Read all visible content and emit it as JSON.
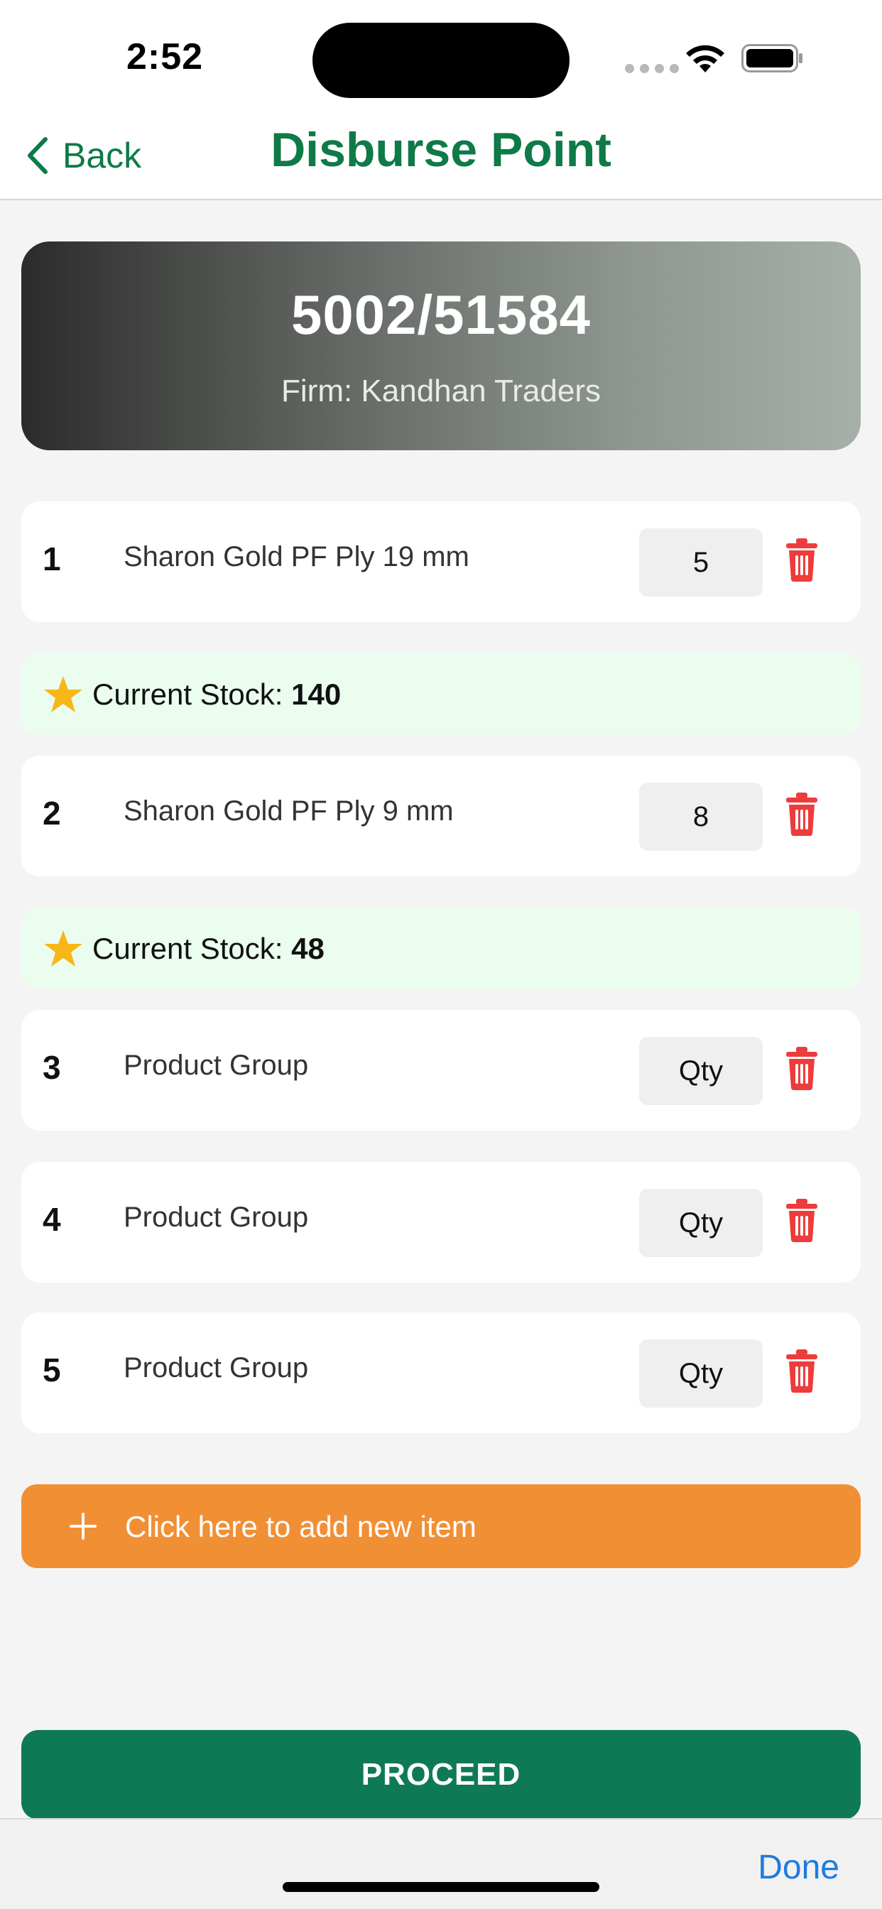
{
  "status": {
    "time": "2:52"
  },
  "nav": {
    "back_label": "Back",
    "title": "Disburse Point"
  },
  "header": {
    "bill_number": "5002/51584",
    "firm_line": "Firm: Kandhan Traders"
  },
  "items": [
    {
      "index": "1",
      "name": "Sharon Gold PF Ply 19 mm",
      "qty": "5",
      "stock_label": "Current Stock: ",
      "stock_value": "140"
    },
    {
      "index": "2",
      "name": "Sharon Gold PF Ply 9 mm",
      "qty": "8",
      "stock_label": "Current Stock: ",
      "stock_value": "48"
    },
    {
      "index": "3",
      "name": "Product Group",
      "qty_placeholder": "Qty"
    },
    {
      "index": "4",
      "name": "Product Group",
      "qty_placeholder": "Qty"
    },
    {
      "index": "5",
      "name": "Product Group",
      "qty_placeholder": "Qty"
    }
  ],
  "add_item_label": "Click here to add new item",
  "proceed_label": "PROCEED",
  "keyboard_done_label": "Done",
  "icons": {
    "back": "chevron-left-icon",
    "delete": "trash-icon",
    "stock": "star-icon",
    "add": "plus-icon"
  },
  "colors": {
    "brand_green": "#0e7a47",
    "delete_red": "#ee3b3b",
    "add_orange": "#f18f35",
    "stock_bg": "#eafdee",
    "star": "#f7b718",
    "done_blue": "#1e7be0"
  }
}
